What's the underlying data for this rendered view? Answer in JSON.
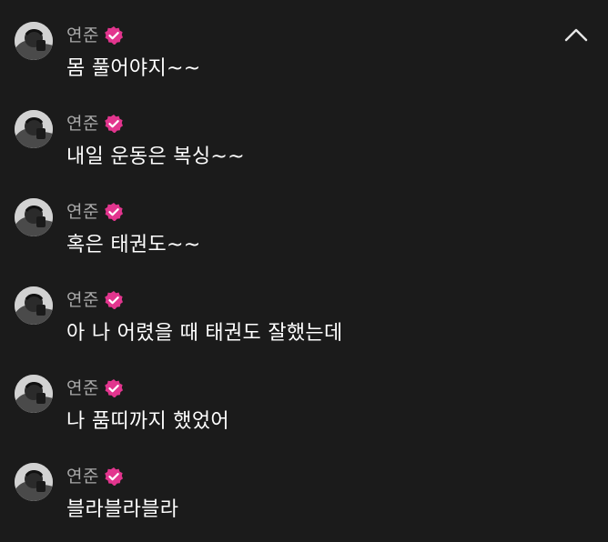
{
  "colors": {
    "background": "#1b1b1b",
    "author_text": "#a9a9a9",
    "message_text": "#ffffff",
    "badge": "#e2358e"
  },
  "header": {
    "collapse_icon": "chevron-up-icon"
  },
  "messages": [
    {
      "author": "연준",
      "verified": true,
      "text": "몸 풀어야지~~"
    },
    {
      "author": "연준",
      "verified": true,
      "text": "내일 운동은 복싱~~"
    },
    {
      "author": "연준",
      "verified": true,
      "text": "혹은 태권도~~"
    },
    {
      "author": "연준",
      "verified": true,
      "text": "아 나 어렸을 때 태권도 잘했는데"
    },
    {
      "author": "연준",
      "verified": true,
      "text": "나 품띠까지 했었어"
    },
    {
      "author": "연준",
      "verified": true,
      "text": "블라블라블라"
    }
  ]
}
